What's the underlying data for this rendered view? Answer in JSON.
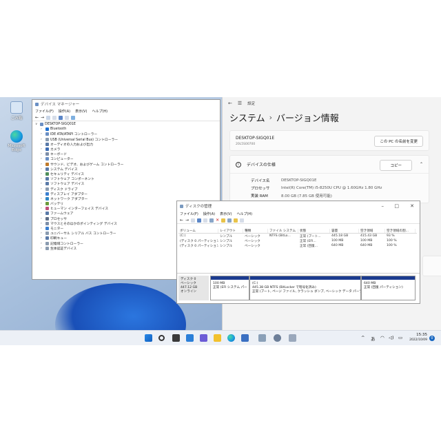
{
  "desktop": {
    "icons": [
      {
        "label": "ごみ箱",
        "icon": "recycle-bin-icon"
      },
      {
        "label": "Microsoft Edge",
        "icon": "edge-icon"
      }
    ]
  },
  "device_manager": {
    "title": "デバイス マネージャー",
    "menu": [
      "ファイル(F)",
      "操作(A)",
      "表示(V)",
      "ヘルプ(H)"
    ],
    "root": "DESKTOP-SIGQ01E",
    "items": [
      "Bluetooth",
      "IDE ATA/ATAPI コントローラー",
      "USB (Universal Serial Bus) コントローラー",
      "オーディオの入力および出力",
      "カメラ",
      "キーボード",
      "コンピューター",
      "サウンド、ビデオ、およびゲーム コントローラー",
      "システム デバイス",
      "セキュリティ デバイス",
      "ソフトウェア コンポーネント",
      "ソフトウェア デバイス",
      "ディスク ドライブ",
      "ディスプレイ アダプター",
      "ネットワーク アダプター",
      "バッテリ",
      "ヒューマン インターフェイス デバイス",
      "ファームウェア",
      "プロセッサ",
      "マウスとそのほかのポインティング デバイス",
      "モニター",
      "ユニバーサル シリアル バス コントローラー",
      "印刷キュー",
      "記憶域コントローラー",
      "生体認証デバイス"
    ]
  },
  "settings": {
    "title": "設定",
    "breadcrumb_parent": "システム",
    "breadcrumb_sep": "›",
    "breadcrumb_current": "バージョン情報",
    "device_name": "DESKTOP-SIGQ01E",
    "device_model": "20L5S00700",
    "rename_button": "この PC の名前を変更",
    "spec_section": "デバイスの仕様",
    "copy_button": "コピー",
    "specs": [
      {
        "label": "デバイス名",
        "value": "DESKTOP-SIGQ01E"
      },
      {
        "label": "プロセッサ",
        "value": "Intel(R) Core(TM) i5-8250U CPU @ 1.60GHz   1.80 GHz"
      },
      {
        "label": "実装 RAM",
        "value": "8.00 GB (7.85 GB 使用可能)"
      }
    ]
  },
  "disk_mgmt": {
    "title": "ディスクの管理",
    "menu": [
      "ファイル(F)",
      "操作(A)",
      "表示(V)",
      "ヘルプ(H)"
    ],
    "columns": [
      "ボリューム",
      "レイアウト",
      "種類",
      "ファイル システム",
      "状態",
      "容量",
      "空き領域",
      "空き領域の割..."
    ],
    "rows": [
      [
        "(C:)",
        "シンプル",
        "ベーシック",
        "NTFS (BitLo...",
        "正常 (ブート...",
        "445.18 GB",
        "415.43 GB",
        "93 %"
      ],
      [
        "(ディスク 0 パーティション...",
        "シンプル",
        "ベーシック",
        "",
        "正常 (EFI...",
        "100 MB",
        "100 MB",
        "100 %"
      ],
      [
        "(ディスク 0 パーティション...",
        "シンプル",
        "ベーシック",
        "",
        "正常 (回復...",
        "640 MB",
        "640 MB",
        "100 %"
      ]
    ],
    "disk": {
      "name": "ディスク 0",
      "type": "ベーシック",
      "size": "447.12 GB",
      "status": "オンライン",
      "partitions": [
        {
          "line1": "100 MB",
          "line2": "正常 (EFI システム パー"
        },
        {
          "line1": "(C:)",
          "line2": "445.38 GB NTFS (BitLocker で暗号化済み)",
          "line3": "正常 (ブート, ページ ファイル, クラッシュ ダンプ, ベーシック データ パーティ"
        },
        {
          "line1": "640 MB",
          "line2": "正常 (回復 パーティション)"
        }
      ]
    }
  },
  "taskbar": {
    "time": "15:35",
    "date": "2022/10/09",
    "ime": "あ",
    "tray_up": "^",
    "notification_count": "0"
  }
}
